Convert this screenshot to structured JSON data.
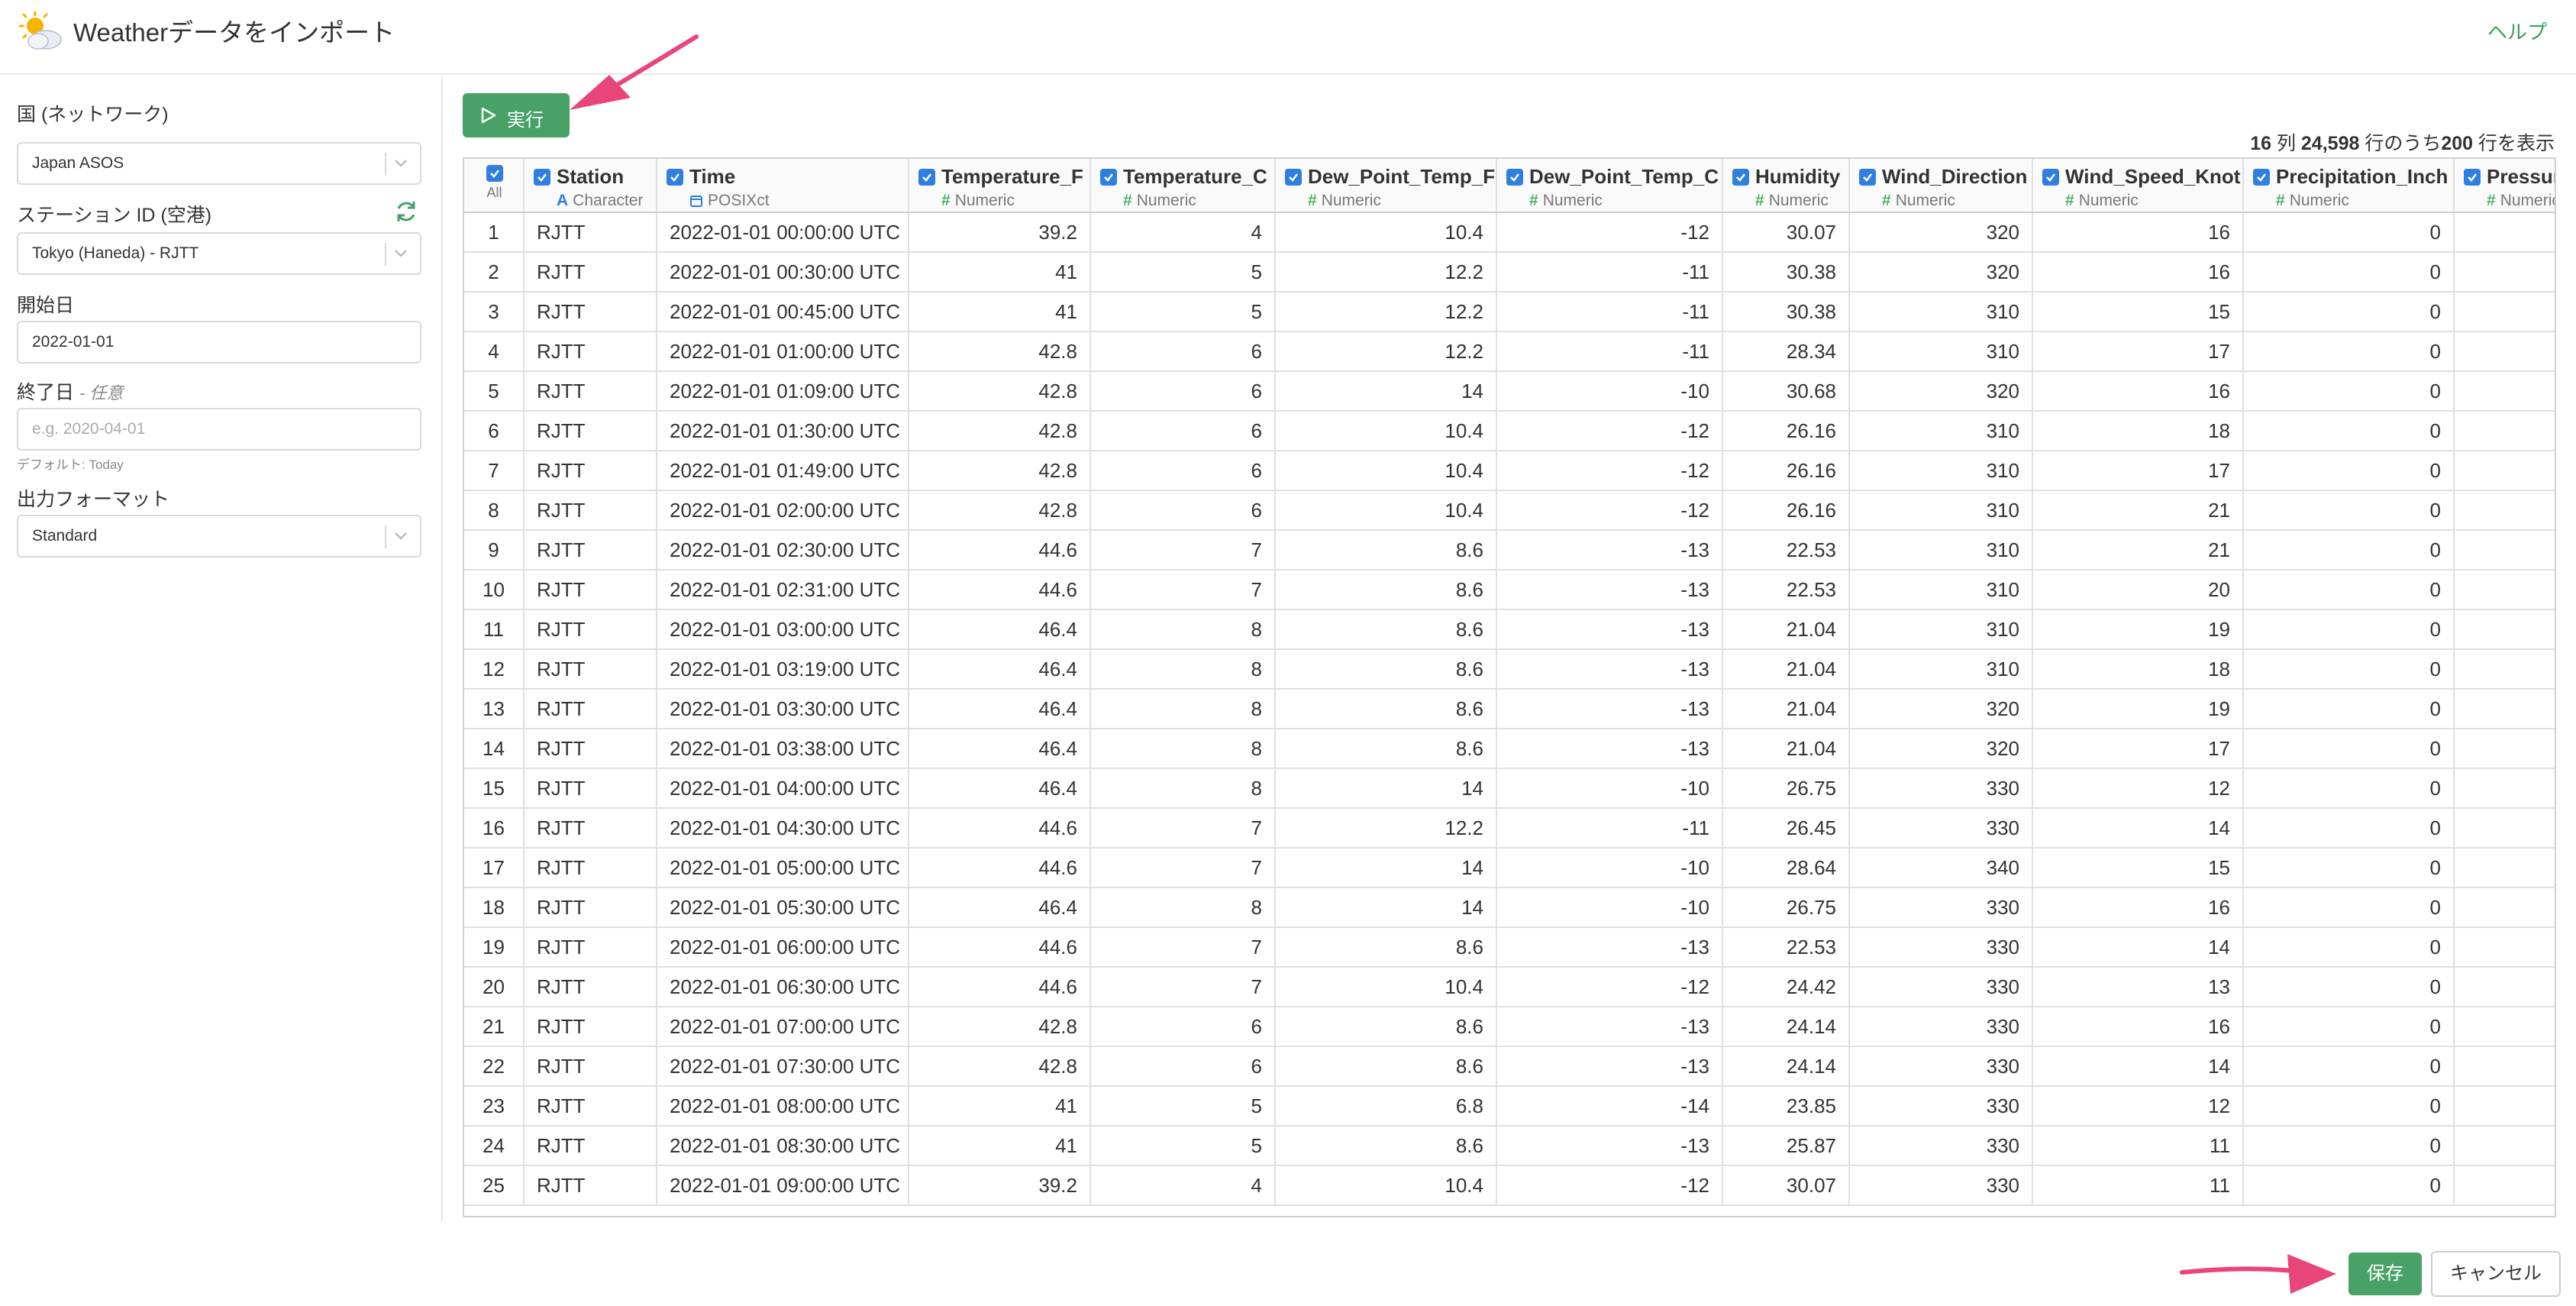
{
  "titlebar": {
    "title": "Weatherデータをインポート",
    "help": "ヘルプ",
    "icon": "weather-sun-cloud-icon"
  },
  "sidebar": {
    "country_label": "国 (ネットワーク)",
    "country_value": "Japan ASOS",
    "station_label": "ステーション ID (空港)",
    "station_value": "Tokyo (Haneda) - RJTT",
    "start_label": "開始日",
    "start_value": "2022-01-01",
    "end_label": "終了日",
    "end_optional": "- 任意",
    "end_placeholder": "e.g. 2020-04-01",
    "end_hint": "デフォルト: Today",
    "format_label": "出力フォーマット",
    "format_value": "Standard"
  },
  "toolbar": {
    "run_label": "実行"
  },
  "summary": {
    "cols": "16",
    "cols_unit": " 列 ",
    "total": "24,598",
    "middle": " 行のうち",
    "shown": "200",
    "tail": " 行を表示"
  },
  "table": {
    "all_label": "All",
    "columns": [
      {
        "name": "Station",
        "type": "Character",
        "kind": "char"
      },
      {
        "name": "Time",
        "type": "POSIXct",
        "kind": "date"
      },
      {
        "name": "Temperature_F",
        "type": "Numeric",
        "kind": "num"
      },
      {
        "name": "Temperature_C",
        "type": "Numeric",
        "kind": "num"
      },
      {
        "name": "Dew_Point_Temp_F",
        "type": "Numeric",
        "kind": "num"
      },
      {
        "name": "Dew_Point_Temp_C",
        "type": "Numeric",
        "kind": "num"
      },
      {
        "name": "Humidity",
        "type": "Numeric",
        "kind": "num"
      },
      {
        "name": "Wind_Direction",
        "type": "Numeric",
        "kind": "num"
      },
      {
        "name": "Wind_Speed_Knot",
        "type": "Numeric",
        "kind": "num"
      },
      {
        "name": "Precipitation_Inch",
        "type": "Numeric",
        "kind": "num"
      },
      {
        "name": "Pressure_Inch",
        "type": "Numeric",
        "kind": "num"
      }
    ],
    "rows": [
      [
        "1",
        "RJTT",
        "2022-01-01 00:00:00 UTC",
        "39.2",
        "4",
        "10.4",
        "-12",
        "30.07",
        "320",
        "16",
        "0",
        ""
      ],
      [
        "2",
        "RJTT",
        "2022-01-01 00:30:00 UTC",
        "41",
        "5",
        "12.2",
        "-11",
        "30.38",
        "320",
        "16",
        "0",
        ""
      ],
      [
        "3",
        "RJTT",
        "2022-01-01 00:45:00 UTC",
        "41",
        "5",
        "12.2",
        "-11",
        "30.38",
        "310",
        "15",
        "0",
        ""
      ],
      [
        "4",
        "RJTT",
        "2022-01-01 01:00:00 UTC",
        "42.8",
        "6",
        "12.2",
        "-11",
        "28.34",
        "310",
        "17",
        "0",
        ""
      ],
      [
        "5",
        "RJTT",
        "2022-01-01 01:09:00 UTC",
        "42.8",
        "6",
        "14",
        "-10",
        "30.68",
        "320",
        "16",
        "0",
        ""
      ],
      [
        "6",
        "RJTT",
        "2022-01-01 01:30:00 UTC",
        "42.8",
        "6",
        "10.4",
        "-12",
        "26.16",
        "310",
        "18",
        "0",
        ""
      ],
      [
        "7",
        "RJTT",
        "2022-01-01 01:49:00 UTC",
        "42.8",
        "6",
        "10.4",
        "-12",
        "26.16",
        "310",
        "17",
        "0",
        ""
      ],
      [
        "8",
        "RJTT",
        "2022-01-01 02:00:00 UTC",
        "42.8",
        "6",
        "10.4",
        "-12",
        "26.16",
        "310",
        "21",
        "0",
        ""
      ],
      [
        "9",
        "RJTT",
        "2022-01-01 02:30:00 UTC",
        "44.6",
        "7",
        "8.6",
        "-13",
        "22.53",
        "310",
        "21",
        "0",
        ""
      ],
      [
        "10",
        "RJTT",
        "2022-01-01 02:31:00 UTC",
        "44.6",
        "7",
        "8.6",
        "-13",
        "22.53",
        "310",
        "20",
        "0",
        ""
      ],
      [
        "11",
        "RJTT",
        "2022-01-01 03:00:00 UTC",
        "46.4",
        "8",
        "8.6",
        "-13",
        "21.04",
        "310",
        "19",
        "0",
        ""
      ],
      [
        "12",
        "RJTT",
        "2022-01-01 03:19:00 UTC",
        "46.4",
        "8",
        "8.6",
        "-13",
        "21.04",
        "310",
        "18",
        "0",
        ""
      ],
      [
        "13",
        "RJTT",
        "2022-01-01 03:30:00 UTC",
        "46.4",
        "8",
        "8.6",
        "-13",
        "21.04",
        "320",
        "19",
        "0",
        ""
      ],
      [
        "14",
        "RJTT",
        "2022-01-01 03:38:00 UTC",
        "46.4",
        "8",
        "8.6",
        "-13",
        "21.04",
        "320",
        "17",
        "0",
        ""
      ],
      [
        "15",
        "RJTT",
        "2022-01-01 04:00:00 UTC",
        "46.4",
        "8",
        "14",
        "-10",
        "26.75",
        "330",
        "12",
        "0",
        ""
      ],
      [
        "16",
        "RJTT",
        "2022-01-01 04:30:00 UTC",
        "44.6",
        "7",
        "12.2",
        "-11",
        "26.45",
        "330",
        "14",
        "0",
        ""
      ],
      [
        "17",
        "RJTT",
        "2022-01-01 05:00:00 UTC",
        "44.6",
        "7",
        "14",
        "-10",
        "28.64",
        "340",
        "15",
        "0",
        ""
      ],
      [
        "18",
        "RJTT",
        "2022-01-01 05:30:00 UTC",
        "46.4",
        "8",
        "14",
        "-10",
        "26.75",
        "330",
        "16",
        "0",
        ""
      ],
      [
        "19",
        "RJTT",
        "2022-01-01 06:00:00 UTC",
        "44.6",
        "7",
        "8.6",
        "-13",
        "22.53",
        "330",
        "14",
        "0",
        ""
      ],
      [
        "20",
        "RJTT",
        "2022-01-01 06:30:00 UTC",
        "44.6",
        "7",
        "10.4",
        "-12",
        "24.42",
        "330",
        "13",
        "0",
        ""
      ],
      [
        "21",
        "RJTT",
        "2022-01-01 07:00:00 UTC",
        "42.8",
        "6",
        "8.6",
        "-13",
        "24.14",
        "330",
        "16",
        "0",
        ""
      ],
      [
        "22",
        "RJTT",
        "2022-01-01 07:30:00 UTC",
        "42.8",
        "6",
        "8.6",
        "-13",
        "24.14",
        "330",
        "14",
        "0",
        ""
      ],
      [
        "23",
        "RJTT",
        "2022-01-01 08:00:00 UTC",
        "41",
        "5",
        "6.8",
        "-14",
        "23.85",
        "330",
        "12",
        "0",
        ""
      ],
      [
        "24",
        "RJTT",
        "2022-01-01 08:30:00 UTC",
        "41",
        "5",
        "8.6",
        "-13",
        "25.87",
        "330",
        "11",
        "0",
        ""
      ],
      [
        "25",
        "RJTT",
        "2022-01-01 09:00:00 UTC",
        "39.2",
        "4",
        "10.4",
        "-12",
        "30.07",
        "330",
        "11",
        "0",
        ""
      ]
    ]
  },
  "footer": {
    "save_label": "保存",
    "cancel_label": "キャンセル"
  },
  "colors": {
    "accent_green": "#48a167",
    "checkbox_blue": "#2f7fe0",
    "annotation_arrow": "#e8457a"
  }
}
